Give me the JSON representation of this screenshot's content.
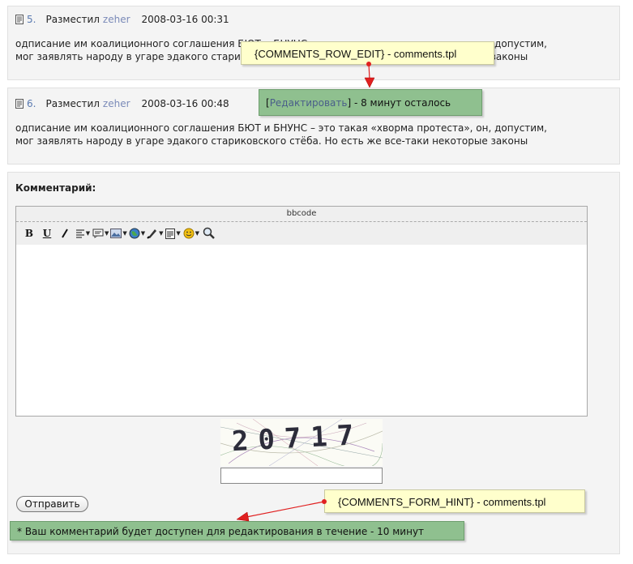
{
  "comments": [
    {
      "number": "5.",
      "posted_by": "Разместил",
      "user": "zeher",
      "date": "2008-03-16 00:31",
      "line1": "одписание им коалиционного соглашения БЮТ и БНУНС – это такая «хворма протеста», он, допустим,",
      "line2": "мог заявлять народу в угаре эдакого стариковского стёба. Но есть же все-таки некоторые законы"
    },
    {
      "number": "6.",
      "posted_by": "Разместил",
      "user": "zeher",
      "date": "2008-03-16 00:48",
      "line1": "одписание им коалиционного соглашения БЮТ и БНУНС – это такая «хворма протеста», он, допустим,",
      "line2": "мог заявлять народу в угаре эдакого стариковского стёба. Но есть же все-таки некоторые законы"
    }
  ],
  "edit_note": {
    "bracket_open": "[",
    "link": "Редактировать",
    "bracket_close": "]",
    "remaining": " - 8 минут осталось"
  },
  "annotations": {
    "row_edit_var": "{COMMENTS_ROW_EDIT}",
    "row_edit_file": " - comments.tpl",
    "form_hint_var": "{COMMENTS_FORM_HINT}",
    "form_hint_file": " - comments.tpl"
  },
  "form": {
    "heading": "Комментарий:",
    "editor_title": "bbcode",
    "toolbar": [
      "bold",
      "underline",
      "italic",
      "align",
      "quote",
      "image",
      "link",
      "color",
      "clipboard",
      "smile",
      "search"
    ],
    "captcha_code": "20717",
    "captcha_value": "",
    "submit_label": "Отправить",
    "hint": "* Ваш комментарий будет доступен для редактирования в течение - 10 минут"
  },
  "colors": {
    "note_yellow": "#ffffcc",
    "note_green": "#8fc08f",
    "arrow_red": "#e02020",
    "link_blue": "#5a7ab0"
  }
}
